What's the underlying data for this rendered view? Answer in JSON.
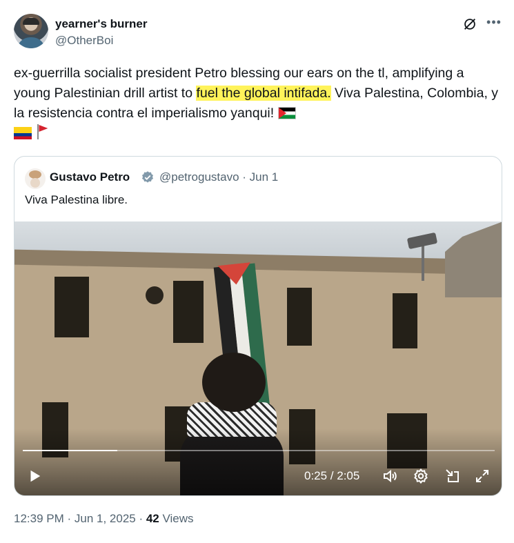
{
  "author": {
    "display_name": "yearner's burner",
    "handle": "@OtherBoi"
  },
  "tweet": {
    "text_before": "ex-guerrilla socialist president Petro blessing our ears on the tl, amplifying a young Palestinian drill artist to ",
    "text_highlight": "fuel the global intifada.",
    "text_after": " Viva Palestina, Colombia, y la resistencia contra el imperialismo yanqui! ",
    "highlight_color": "#fff35a"
  },
  "quote": {
    "display_name": "Gustavo Petro",
    "handle_date": "@petrogustavo · Jun 1",
    "text": "Viva Palestina libre.",
    "verified_color": "#829aab"
  },
  "video": {
    "time": "0:25 / 2:05",
    "progress": 0.2
  },
  "meta": {
    "timestamp": "12:39 PM · Jun 1, 2025 · ",
    "views_count": "42",
    "views_label": " Views"
  },
  "icons": [
    "grok-icon",
    "more-icon",
    "verified-icon",
    "play-icon",
    "volume-icon",
    "settings-icon",
    "minimize-icon",
    "fullscreen-icon"
  ]
}
